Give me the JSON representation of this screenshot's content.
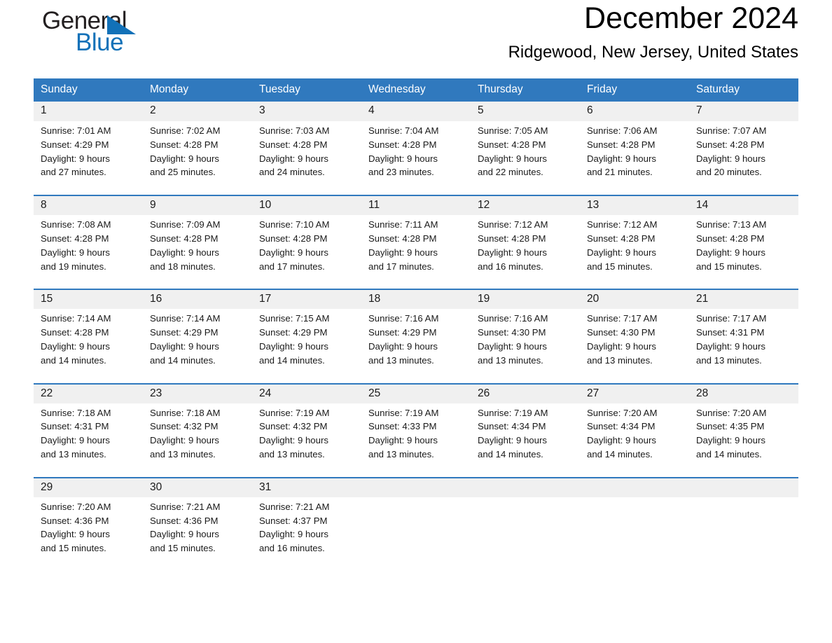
{
  "brand": {
    "name_part1": "General",
    "name_part2": "Blue",
    "triangle_color": "#1271b8"
  },
  "header": {
    "month_title": "December 2024",
    "location": "Ridgewood, New Jersey, United States",
    "accent_color": "#3079be",
    "band_color": "#f0f0f0"
  },
  "weekday_headers": [
    "Sunday",
    "Monday",
    "Tuesday",
    "Wednesday",
    "Thursday",
    "Friday",
    "Saturday"
  ],
  "weeks": [
    {
      "days": [
        {
          "date": "1",
          "sunrise": "Sunrise: 7:01 AM",
          "sunset": "Sunset: 4:29 PM",
          "daylight_line1": "Daylight: 9 hours",
          "daylight_line2": "and 27 minutes."
        },
        {
          "date": "2",
          "sunrise": "Sunrise: 7:02 AM",
          "sunset": "Sunset: 4:28 PM",
          "daylight_line1": "Daylight: 9 hours",
          "daylight_line2": "and 25 minutes."
        },
        {
          "date": "3",
          "sunrise": "Sunrise: 7:03 AM",
          "sunset": "Sunset: 4:28 PM",
          "daylight_line1": "Daylight: 9 hours",
          "daylight_line2": "and 24 minutes."
        },
        {
          "date": "4",
          "sunrise": "Sunrise: 7:04 AM",
          "sunset": "Sunset: 4:28 PM",
          "daylight_line1": "Daylight: 9 hours",
          "daylight_line2": "and 23 minutes."
        },
        {
          "date": "5",
          "sunrise": "Sunrise: 7:05 AM",
          "sunset": "Sunset: 4:28 PM",
          "daylight_line1": "Daylight: 9 hours",
          "daylight_line2": "and 22 minutes."
        },
        {
          "date": "6",
          "sunrise": "Sunrise: 7:06 AM",
          "sunset": "Sunset: 4:28 PM",
          "daylight_line1": "Daylight: 9 hours",
          "daylight_line2": "and 21 minutes."
        },
        {
          "date": "7",
          "sunrise": "Sunrise: 7:07 AM",
          "sunset": "Sunset: 4:28 PM",
          "daylight_line1": "Daylight: 9 hours",
          "daylight_line2": "and 20 minutes."
        }
      ]
    },
    {
      "days": [
        {
          "date": "8",
          "sunrise": "Sunrise: 7:08 AM",
          "sunset": "Sunset: 4:28 PM",
          "daylight_line1": "Daylight: 9 hours",
          "daylight_line2": "and 19 minutes."
        },
        {
          "date": "9",
          "sunrise": "Sunrise: 7:09 AM",
          "sunset": "Sunset: 4:28 PM",
          "daylight_line1": "Daylight: 9 hours",
          "daylight_line2": "and 18 minutes."
        },
        {
          "date": "10",
          "sunrise": "Sunrise: 7:10 AM",
          "sunset": "Sunset: 4:28 PM",
          "daylight_line1": "Daylight: 9 hours",
          "daylight_line2": "and 17 minutes."
        },
        {
          "date": "11",
          "sunrise": "Sunrise: 7:11 AM",
          "sunset": "Sunset: 4:28 PM",
          "daylight_line1": "Daylight: 9 hours",
          "daylight_line2": "and 17 minutes."
        },
        {
          "date": "12",
          "sunrise": "Sunrise: 7:12 AM",
          "sunset": "Sunset: 4:28 PM",
          "daylight_line1": "Daylight: 9 hours",
          "daylight_line2": "and 16 minutes."
        },
        {
          "date": "13",
          "sunrise": "Sunrise: 7:12 AM",
          "sunset": "Sunset: 4:28 PM",
          "daylight_line1": "Daylight: 9 hours",
          "daylight_line2": "and 15 minutes."
        },
        {
          "date": "14",
          "sunrise": "Sunrise: 7:13 AM",
          "sunset": "Sunset: 4:28 PM",
          "daylight_line1": "Daylight: 9 hours",
          "daylight_line2": "and 15 minutes."
        }
      ]
    },
    {
      "days": [
        {
          "date": "15",
          "sunrise": "Sunrise: 7:14 AM",
          "sunset": "Sunset: 4:28 PM",
          "daylight_line1": "Daylight: 9 hours",
          "daylight_line2": "and 14 minutes."
        },
        {
          "date": "16",
          "sunrise": "Sunrise: 7:14 AM",
          "sunset": "Sunset: 4:29 PM",
          "daylight_line1": "Daylight: 9 hours",
          "daylight_line2": "and 14 minutes."
        },
        {
          "date": "17",
          "sunrise": "Sunrise: 7:15 AM",
          "sunset": "Sunset: 4:29 PM",
          "daylight_line1": "Daylight: 9 hours",
          "daylight_line2": "and 14 minutes."
        },
        {
          "date": "18",
          "sunrise": "Sunrise: 7:16 AM",
          "sunset": "Sunset: 4:29 PM",
          "daylight_line1": "Daylight: 9 hours",
          "daylight_line2": "and 13 minutes."
        },
        {
          "date": "19",
          "sunrise": "Sunrise: 7:16 AM",
          "sunset": "Sunset: 4:30 PM",
          "daylight_line1": "Daylight: 9 hours",
          "daylight_line2": "and 13 minutes."
        },
        {
          "date": "20",
          "sunrise": "Sunrise: 7:17 AM",
          "sunset": "Sunset: 4:30 PM",
          "daylight_line1": "Daylight: 9 hours",
          "daylight_line2": "and 13 minutes."
        },
        {
          "date": "21",
          "sunrise": "Sunrise: 7:17 AM",
          "sunset": "Sunset: 4:31 PM",
          "daylight_line1": "Daylight: 9 hours",
          "daylight_line2": "and 13 minutes."
        }
      ]
    },
    {
      "days": [
        {
          "date": "22",
          "sunrise": "Sunrise: 7:18 AM",
          "sunset": "Sunset: 4:31 PM",
          "daylight_line1": "Daylight: 9 hours",
          "daylight_line2": "and 13 minutes."
        },
        {
          "date": "23",
          "sunrise": "Sunrise: 7:18 AM",
          "sunset": "Sunset: 4:32 PM",
          "daylight_line1": "Daylight: 9 hours",
          "daylight_line2": "and 13 minutes."
        },
        {
          "date": "24",
          "sunrise": "Sunrise: 7:19 AM",
          "sunset": "Sunset: 4:32 PM",
          "daylight_line1": "Daylight: 9 hours",
          "daylight_line2": "and 13 minutes."
        },
        {
          "date": "25",
          "sunrise": "Sunrise: 7:19 AM",
          "sunset": "Sunset: 4:33 PM",
          "daylight_line1": "Daylight: 9 hours",
          "daylight_line2": "and 13 minutes."
        },
        {
          "date": "26",
          "sunrise": "Sunrise: 7:19 AM",
          "sunset": "Sunset: 4:34 PM",
          "daylight_line1": "Daylight: 9 hours",
          "daylight_line2": "and 14 minutes."
        },
        {
          "date": "27",
          "sunrise": "Sunrise: 7:20 AM",
          "sunset": "Sunset: 4:34 PM",
          "daylight_line1": "Daylight: 9 hours",
          "daylight_line2": "and 14 minutes."
        },
        {
          "date": "28",
          "sunrise": "Sunrise: 7:20 AM",
          "sunset": "Sunset: 4:35 PM",
          "daylight_line1": "Daylight: 9 hours",
          "daylight_line2": "and 14 minutes."
        }
      ]
    },
    {
      "days": [
        {
          "date": "29",
          "sunrise": "Sunrise: 7:20 AM",
          "sunset": "Sunset: 4:36 PM",
          "daylight_line1": "Daylight: 9 hours",
          "daylight_line2": "and 15 minutes."
        },
        {
          "date": "30",
          "sunrise": "Sunrise: 7:21 AM",
          "sunset": "Sunset: 4:36 PM",
          "daylight_line1": "Daylight: 9 hours",
          "daylight_line2": "and 15 minutes."
        },
        {
          "date": "31",
          "sunrise": "Sunrise: 7:21 AM",
          "sunset": "Sunset: 4:37 PM",
          "daylight_line1": "Daylight: 9 hours",
          "daylight_line2": "and 16 minutes."
        },
        {
          "date": "",
          "sunrise": "",
          "sunset": "",
          "daylight_line1": "",
          "daylight_line2": ""
        },
        {
          "date": "",
          "sunrise": "",
          "sunset": "",
          "daylight_line1": "",
          "daylight_line2": ""
        },
        {
          "date": "",
          "sunrise": "",
          "sunset": "",
          "daylight_line1": "",
          "daylight_line2": ""
        },
        {
          "date": "",
          "sunrise": "",
          "sunset": "",
          "daylight_line1": "",
          "daylight_line2": ""
        }
      ]
    }
  ]
}
